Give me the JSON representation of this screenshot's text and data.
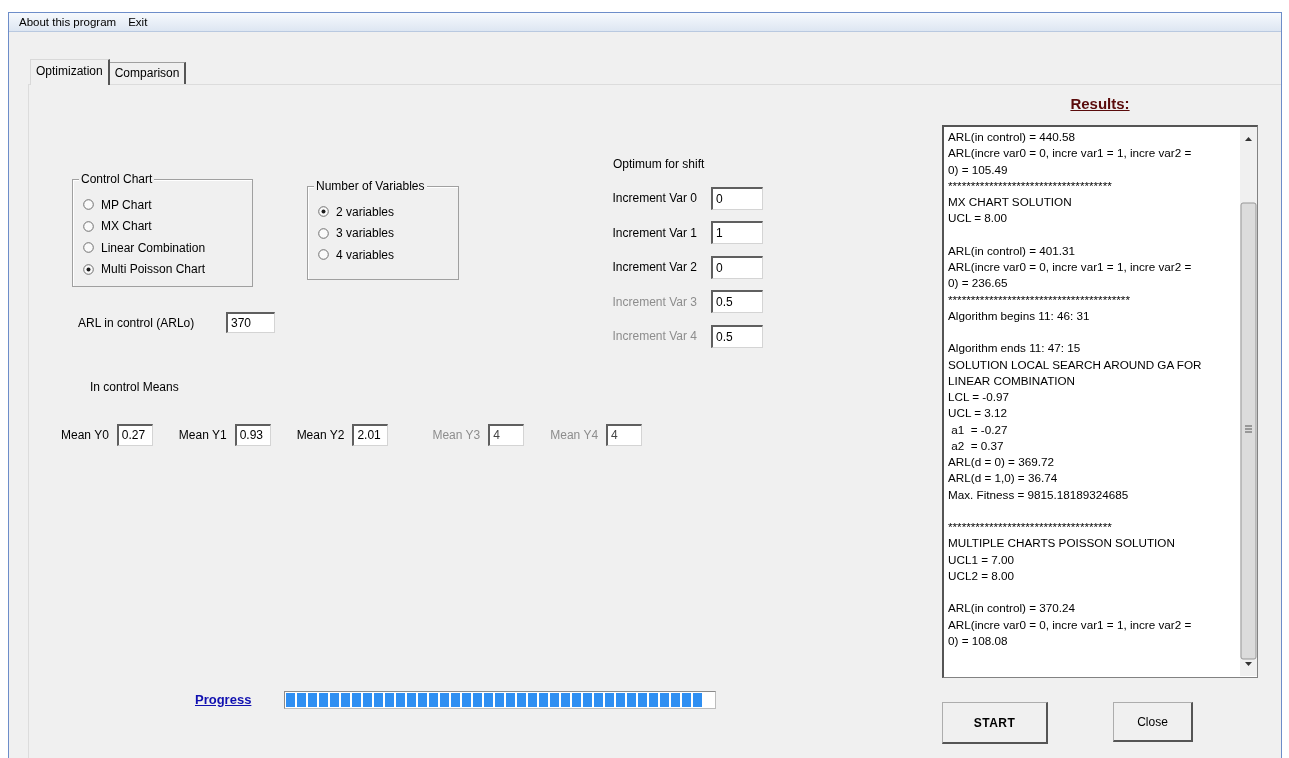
{
  "menu": [
    "About this program",
    "Exit"
  ],
  "tabs": [
    {
      "label": "Optimization",
      "selected": true
    },
    {
      "label": "Comparison",
      "selected": false
    }
  ],
  "control_chart": {
    "title": "Control Chart",
    "options": [
      {
        "label": "MP Chart",
        "selected": false
      },
      {
        "label": "MX Chart",
        "selected": false
      },
      {
        "label": "Linear Combination",
        "selected": false
      },
      {
        "label": "Multi Poisson Chart",
        "selected": true
      }
    ]
  },
  "number_of_variables": {
    "title": "Number of Variables",
    "options": [
      {
        "label": "2 variables",
        "selected": true
      },
      {
        "label": "3 variables",
        "selected": false
      },
      {
        "label": "4 variables",
        "selected": false
      }
    ]
  },
  "arl_in_control": {
    "label": "ARL in control (ARLo)",
    "value": "370"
  },
  "optimum": {
    "title": "Optimum for shift",
    "increments": [
      {
        "label": "Increment Var 0",
        "value": "0",
        "disabled": false
      },
      {
        "label": "Increment Var 1",
        "value": "1",
        "disabled": false
      },
      {
        "label": "Increment Var 2",
        "value": "0",
        "disabled": false
      },
      {
        "label": "Increment Var 3",
        "value": "0.5",
        "disabled": true
      },
      {
        "label": "Increment Var 4",
        "value": "0.5",
        "disabled": true
      }
    ]
  },
  "means": {
    "title": "In control Means",
    "fields": [
      {
        "label": "Mean Y0",
        "value": "0.27",
        "disabled": false
      },
      {
        "label": "Mean Y1",
        "value": "0.93",
        "disabled": false
      },
      {
        "label": "Mean Y2",
        "value": "2.01",
        "disabled": false
      },
      {
        "label": "Mean Y3",
        "value": "4",
        "disabled": true
      },
      {
        "label": "Mean Y4",
        "value": "4",
        "disabled": true
      }
    ]
  },
  "progress": {
    "label": "Progress",
    "level": 1
  },
  "results": {
    "title": "Results:",
    "text": "ARL(in control) = 440.58\nARL(incre var0 = 0, incre var1 = 1, incre var2 =\n0) = 105.49\n************************************\nMX CHART SOLUTION\nUCL = 8.00\n\nARL(in control) = 401.31\nARL(incre var0 = 0, incre var1 = 1, incre var2 =\n0) = 236.65\n****************************************\nAlgorithm begins 11: 46: 31\n\nAlgorithm ends 11: 47: 15\nSOLUTION LOCAL SEARCH AROUND GA FOR\nLINEAR COMBINATION\nLCL = -0.97\nUCL = 3.12\n a1  = -0.27\n a2  = 0.37\nARL(d = 0) = 369.72\nARL(d = 1,0) = 36.74\nMax. Fitness = 9815.18189324685\n\n************************************\nMULTIPLE CHARTS POISSON SOLUTION\nUCL1 = 7.00\nUCL2 = 8.00\n\nARL(in control) = 370.24\nARL(incre var0 = 0, incre var1 = 1, incre var2 =\n0) = 108.08"
  },
  "buttons": [
    {
      "label": "START",
      "kind": "default"
    },
    {
      "label": "Close",
      "kind": "normal"
    }
  ]
}
